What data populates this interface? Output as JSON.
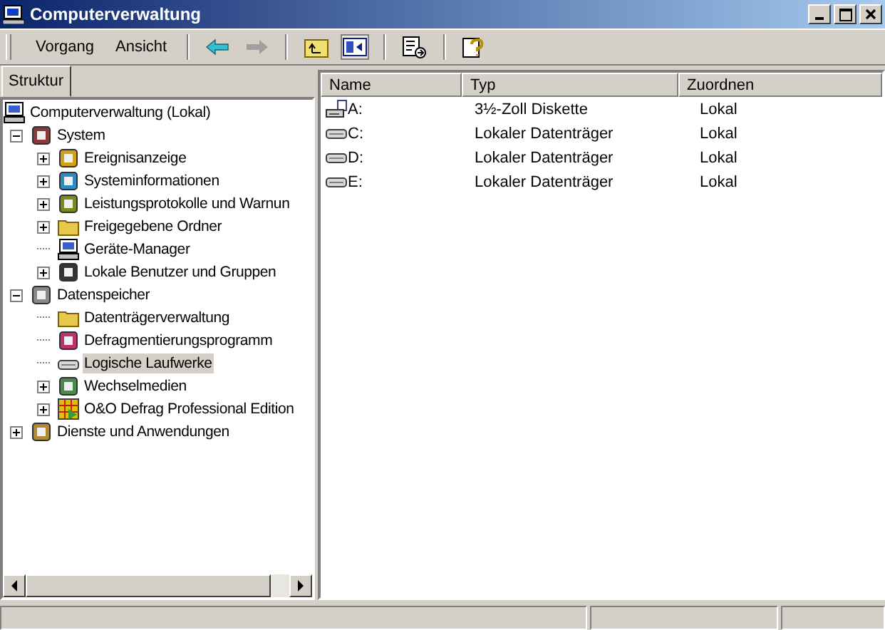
{
  "window": {
    "title": "Computerverwaltung"
  },
  "menu": [
    "Vorgang",
    "Ansicht"
  ],
  "tabs": [
    {
      "label": "Struktur",
      "selected": true
    }
  ],
  "tree": [
    {
      "label": "Computerverwaltung (Lokal)",
      "kind": "computer",
      "selected": false,
      "children": [
        {
          "label": "System",
          "kind": "tools",
          "expandable": true,
          "expanded": true,
          "selected": false,
          "children": [
            {
              "label": "Ereignisanzeige",
              "kind": "log",
              "expandable": true,
              "expanded": false,
              "selected": false
            },
            {
              "label": "Systeminformationen",
              "kind": "info",
              "expandable": true,
              "expanded": false,
              "selected": false
            },
            {
              "label": "Leistungsprotokolle und Warnun",
              "kind": "chart",
              "expandable": true,
              "expanded": false,
              "selected": false
            },
            {
              "label": "Freigegebene Ordner",
              "kind": "folder",
              "expandable": true,
              "expanded": false,
              "selected": false
            },
            {
              "label": "Geräte-Manager",
              "kind": "computer",
              "expandable": false,
              "selected": false
            },
            {
              "label": "Lokale Benutzer und Gruppen",
              "kind": "users",
              "expandable": true,
              "expanded": false,
              "selected": false
            }
          ]
        },
        {
          "label": "Datenspeicher",
          "kind": "storage",
          "expandable": true,
          "expanded": true,
          "selected": false,
          "children": [
            {
              "label": "Datenträgerverwaltung",
              "kind": "folder",
              "expandable": false,
              "selected": false
            },
            {
              "label": "Defragmentierungsprogramm",
              "kind": "defrag",
              "expandable": false,
              "selected": false
            },
            {
              "label": "Logische Laufwerke",
              "kind": "drive",
              "expandable": false,
              "selected": true
            },
            {
              "label": "Wechselmedien",
              "kind": "media",
              "expandable": true,
              "expanded": false,
              "selected": false
            },
            {
              "label": "O&O Defrag Professional Edition",
              "kind": "grid",
              "expandable": true,
              "expanded": false,
              "selected": false
            }
          ]
        },
        {
          "label": "Dienste und Anwendungen",
          "kind": "services",
          "expandable": true,
          "expanded": false,
          "selected": false
        }
      ]
    }
  ],
  "table": {
    "columns": [
      "Name",
      "Typ",
      "Zuordnen"
    ],
    "rows": [
      {
        "kind": "floppy",
        "name": "A:",
        "type": "3½-Zoll Diskette",
        "mapping": "Lokal"
      },
      {
        "kind": "drive",
        "name": "C:",
        "type": "Lokaler Datenträger",
        "mapping": "Lokal"
      },
      {
        "kind": "drive",
        "name": "D:",
        "type": "Lokaler Datenträger",
        "mapping": "Lokal"
      },
      {
        "kind": "drive",
        "name": "E:",
        "type": "Lokaler Datenträger",
        "mapping": "Lokal"
      }
    ]
  }
}
